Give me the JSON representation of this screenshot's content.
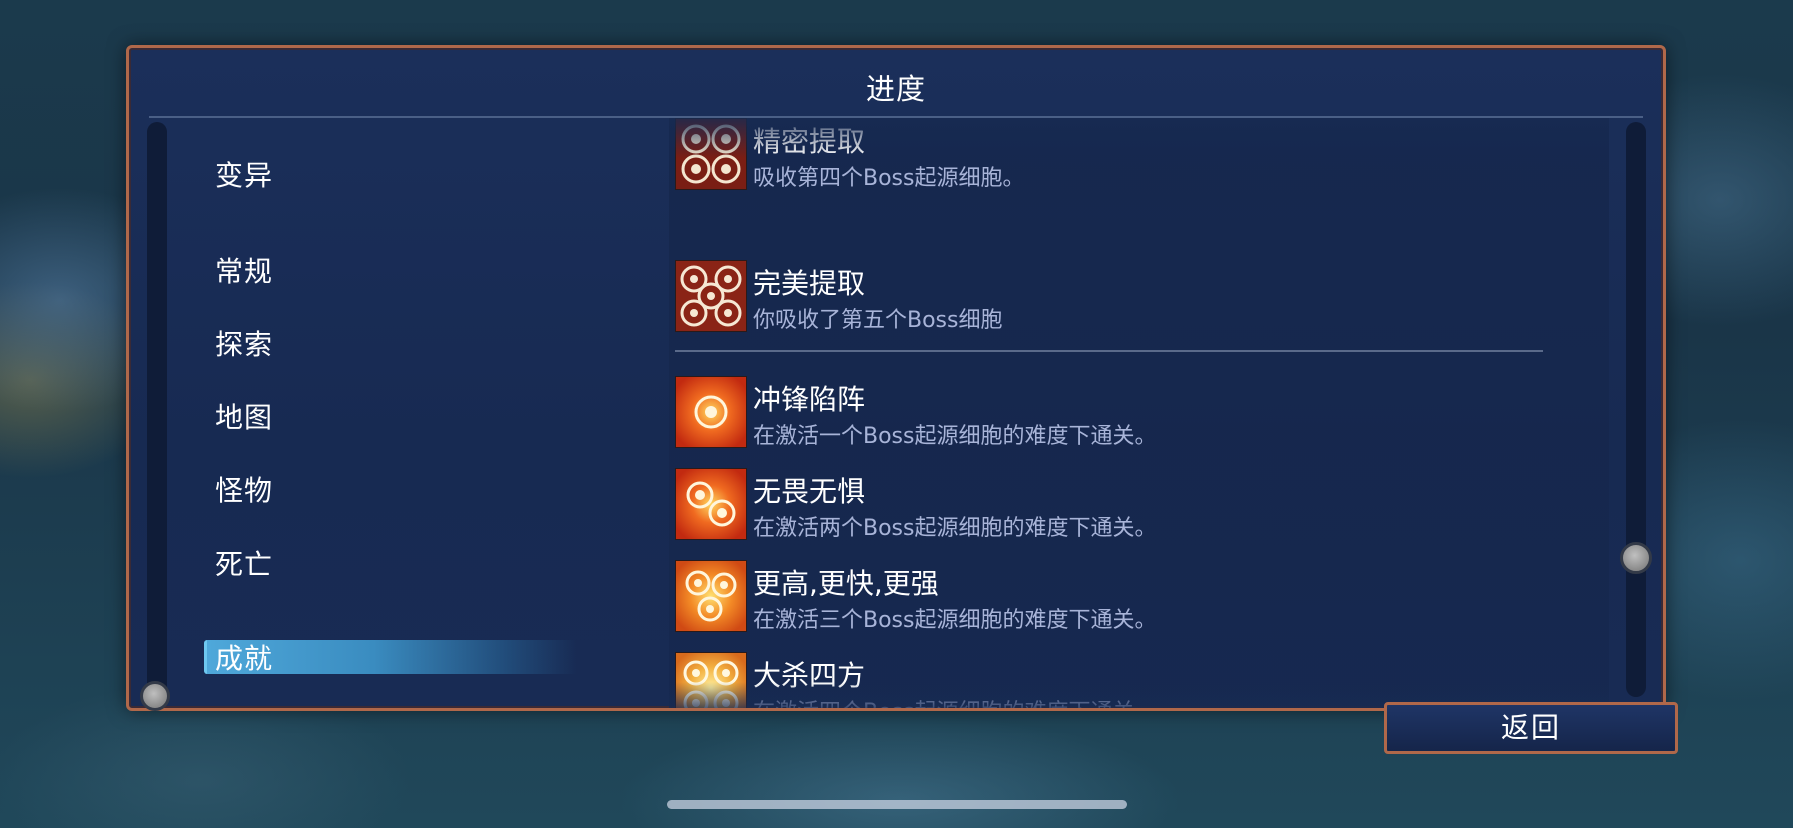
{
  "panel": {
    "title": "进度"
  },
  "categories": [
    {
      "label": "变异",
      "selected": false
    },
    {
      "label": "常规",
      "selected": false
    },
    {
      "label": "探索",
      "selected": false
    },
    {
      "label": "地图",
      "selected": false
    },
    {
      "label": "怪物",
      "selected": false
    },
    {
      "label": "死亡",
      "selected": false
    },
    {
      "label": "成就",
      "selected": true
    }
  ],
  "achievements": [
    {
      "name": "精密提取",
      "desc": "吸收第四个Boss起源细胞。",
      "icon": "boss-cell-4-icon"
    },
    {
      "name": "完美提取",
      "desc": "你吸收了第五个Boss细胞",
      "icon": "boss-cell-5-icon"
    },
    {
      "name": "冲锋陷阵",
      "desc": "在激活一个Boss起源细胞的难度下通关。",
      "icon": "boss-cell-difficulty-1-icon"
    },
    {
      "name": "无畏无惧",
      "desc": "在激活两个Boss起源细胞的难度下通关。",
      "icon": "boss-cell-difficulty-2-icon"
    },
    {
      "name": "更高,更快,更强",
      "desc": "在激活三个Boss起源细胞的难度下通关。",
      "icon": "boss-cell-difficulty-3-icon"
    },
    {
      "name": "大杀四方",
      "desc": "在激活四个Boss起源细胞的难度下通关。",
      "icon": "boss-cell-difficulty-4-icon"
    }
  ],
  "buttons": {
    "back_label": "返回"
  },
  "colors": {
    "panel_border": "#b0684a",
    "panel_bg": "#1b2f5a",
    "selected_highlight": "#4fa8da",
    "desc_text": "#a8b4d8"
  }
}
